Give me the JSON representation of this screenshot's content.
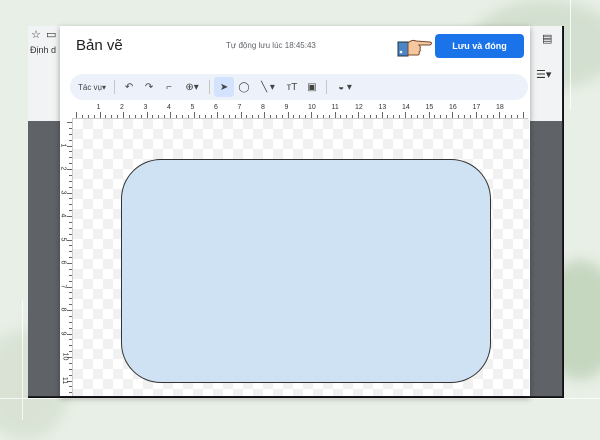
{
  "dialog": {
    "title": "Bản vẽ",
    "autosave": "Tự động lưu lúc 18:45:43",
    "save_close_label": "Lưu và đóng"
  },
  "docs_bg": {
    "side_label": "Định d"
  },
  "toolbar": {
    "actions_label": "Tác vụ",
    "icons": [
      "undo-icon",
      "redo-icon",
      "paint-format-icon",
      "zoom-icon",
      "select-icon",
      "shape-icon",
      "line-icon",
      "text-box-icon",
      "image-icon",
      "fill-color-icon"
    ]
  },
  "ruler": {
    "h_labels": [
      "1",
      "2",
      "3",
      "4",
      "5",
      "6",
      "7",
      "8",
      "9",
      "10",
      "11",
      "12",
      "13",
      "14",
      "15",
      "16",
      "17",
      "18"
    ],
    "v_labels": [
      "1",
      "2",
      "3",
      "4",
      "5",
      "6",
      "7",
      "8",
      "9",
      "10",
      "11"
    ]
  },
  "colors": {
    "accent": "#1a73e8",
    "shape_fill": "#cfe2f3",
    "toolbar_bg": "#edf2fa"
  }
}
